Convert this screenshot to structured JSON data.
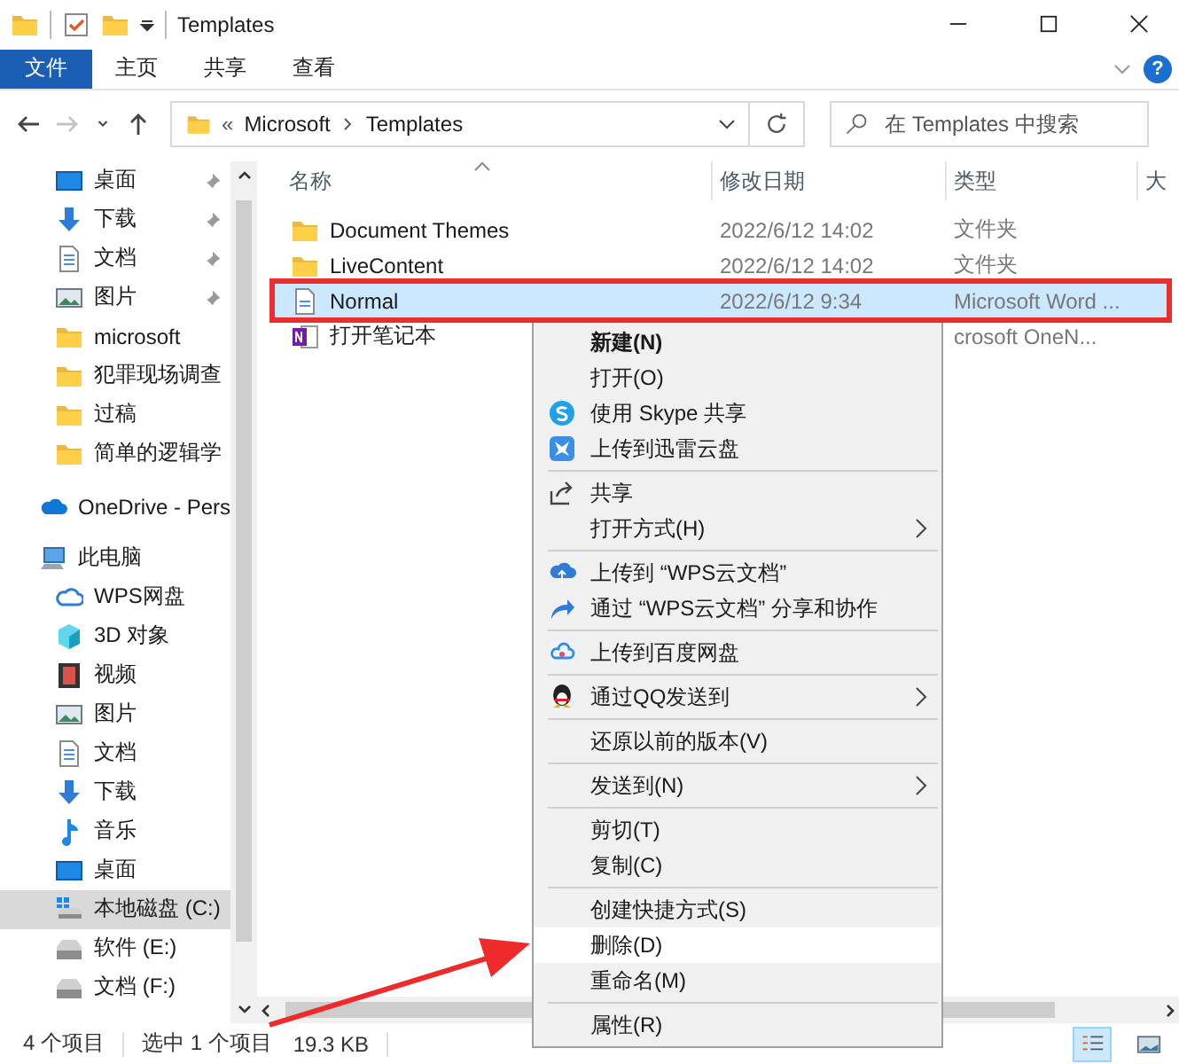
{
  "window": {
    "title": "Templates"
  },
  "ribbon": {
    "tabs": [
      {
        "label": "文件",
        "selected": true
      },
      {
        "label": "主页",
        "selected": false
      },
      {
        "label": "共享",
        "selected": false
      },
      {
        "label": "查看",
        "selected": false
      }
    ],
    "help": "?"
  },
  "nav_buttons": [
    {
      "kind": "back",
      "disabled": false
    },
    {
      "kind": "forward",
      "disabled": true
    },
    {
      "kind": "recent",
      "disabled": false
    },
    {
      "kind": "up",
      "disabled": false
    }
  ],
  "address": {
    "overflow": "«",
    "crumbs": [
      "Microsoft",
      "Templates"
    ]
  },
  "search": {
    "placeholder": "在 Templates 中搜索"
  },
  "sidebar": {
    "quick_access": [
      {
        "label": "桌面",
        "kind": "desktop",
        "pinned": true,
        "selected": false
      },
      {
        "label": "下载",
        "kind": "download",
        "pinned": true,
        "selected": false
      },
      {
        "label": "文档",
        "kind": "document",
        "pinned": true,
        "selected": false
      },
      {
        "label": "图片",
        "kind": "picture",
        "pinned": true,
        "selected": false
      },
      {
        "label": "microsoft",
        "kind": "folder",
        "pinned": false,
        "selected": false
      },
      {
        "label": "犯罪现场调查",
        "kind": "folder",
        "pinned": false,
        "selected": false
      },
      {
        "label": "过稿",
        "kind": "folder",
        "pinned": false,
        "selected": false
      },
      {
        "label": "简单的逻辑学",
        "kind": "folder",
        "pinned": false,
        "selected": false
      }
    ],
    "onedrive": {
      "label": "OneDrive - Pers"
    },
    "this_pc": {
      "label": "此电脑",
      "children": [
        {
          "label": "WPS网盘",
          "kind": "wps-cloud",
          "selected": false
        },
        {
          "label": "3D 对象",
          "kind": "cube",
          "selected": false
        },
        {
          "label": "视频",
          "kind": "video",
          "selected": false
        },
        {
          "label": "图片",
          "kind": "picture",
          "selected": false
        },
        {
          "label": "文档",
          "kind": "document",
          "selected": false
        },
        {
          "label": "下载",
          "kind": "download",
          "selected": false
        },
        {
          "label": "音乐",
          "kind": "music",
          "selected": false
        },
        {
          "label": "桌面",
          "kind": "desktop",
          "selected": false
        },
        {
          "label": "本地磁盘 (C:)",
          "kind": "drive-win",
          "selected": true
        },
        {
          "label": "软件 (E:)",
          "kind": "drive",
          "selected": false
        },
        {
          "label": "文档 (F:)",
          "kind": "drive",
          "selected": false
        }
      ]
    }
  },
  "columns": [
    "名称",
    "修改日期",
    "类型",
    "大"
  ],
  "files": [
    {
      "name": "Document Themes",
      "kind": "folder",
      "date": "2022/6/12 14:02",
      "type": "文件夹",
      "selected": false
    },
    {
      "name": "LiveContent",
      "kind": "folder",
      "date": "2022/6/12 14:02",
      "type": "文件夹",
      "selected": false
    },
    {
      "name": "Normal",
      "kind": "word",
      "date": "2022/6/12 9:34",
      "type": "Microsoft Word ...",
      "selected": true
    },
    {
      "name": "打开笔记本",
      "kind": "onenote",
      "type": "crosoft OneN...",
      "selected": false
    }
  ],
  "context_menu": [
    {
      "kind": "plain",
      "label": "新建(N)",
      "bold": true,
      "submenu": false,
      "hovered": false
    },
    {
      "kind": "plain",
      "label": "打开(O)",
      "bold": false,
      "submenu": false,
      "hovered": false
    },
    {
      "kind": "skype",
      "label": "使用 Skype 共享",
      "bold": false,
      "submenu": false,
      "hovered": false
    },
    {
      "kind": "xunlei",
      "label": "上传到迅雷云盘",
      "bold": false,
      "submenu": false,
      "hovered": false
    },
    {
      "kind": "separator"
    },
    {
      "kind": "share",
      "label": "共享",
      "bold": false,
      "submenu": false,
      "hovered": false
    },
    {
      "kind": "plain",
      "label": "打开方式(H)",
      "bold": false,
      "submenu": true,
      "hovered": false
    },
    {
      "kind": "separator"
    },
    {
      "kind": "wps-up",
      "label": "上传到 “WPS云文档”",
      "bold": false,
      "submenu": false,
      "hovered": false
    },
    {
      "kind": "wps-share",
      "label": "通过 “WPS云文档” 分享和协作",
      "bold": false,
      "submenu": false,
      "hovered": false
    },
    {
      "kind": "separator"
    },
    {
      "kind": "baidu",
      "label": "上传到百度网盘",
      "bold": false,
      "submenu": false,
      "hovered": false
    },
    {
      "kind": "separator"
    },
    {
      "kind": "qq",
      "label": "通过QQ发送到",
      "bold": false,
      "submenu": true,
      "hovered": false
    },
    {
      "kind": "separator"
    },
    {
      "kind": "plain",
      "label": "还原以前的版本(V)",
      "bold": false,
      "submenu": false,
      "hovered": false
    },
    {
      "kind": "separator"
    },
    {
      "kind": "plain",
      "label": "发送到(N)",
      "bold": false,
      "submenu": true,
      "hovered": false
    },
    {
      "kind": "separator"
    },
    {
      "kind": "plain",
      "label": "剪切(T)",
      "bold": false,
      "submenu": false,
      "hovered": false
    },
    {
      "kind": "plain",
      "label": "复制(C)",
      "bold": false,
      "submenu": false,
      "hovered": false
    },
    {
      "kind": "separator"
    },
    {
      "kind": "plain",
      "label": "创建快捷方式(S)",
      "bold": false,
      "submenu": false,
      "hovered": false
    },
    {
      "kind": "plain",
      "label": "删除(D)",
      "bold": false,
      "submenu": false,
      "hovered": true
    },
    {
      "kind": "plain",
      "label": "重命名(M)",
      "bold": false,
      "submenu": false,
      "hovered": false
    },
    {
      "kind": "separator"
    },
    {
      "kind": "plain",
      "label": "属性(R)",
      "bold": false,
      "submenu": false,
      "hovered": false
    }
  ],
  "status_bar": {
    "count": "4 个项目",
    "selection": "选中 1 个项目",
    "size": "19.3 KB",
    "views": [
      {
        "kind": "details",
        "selected": true
      },
      {
        "kind": "thumbnails",
        "selected": false
      }
    ]
  }
}
